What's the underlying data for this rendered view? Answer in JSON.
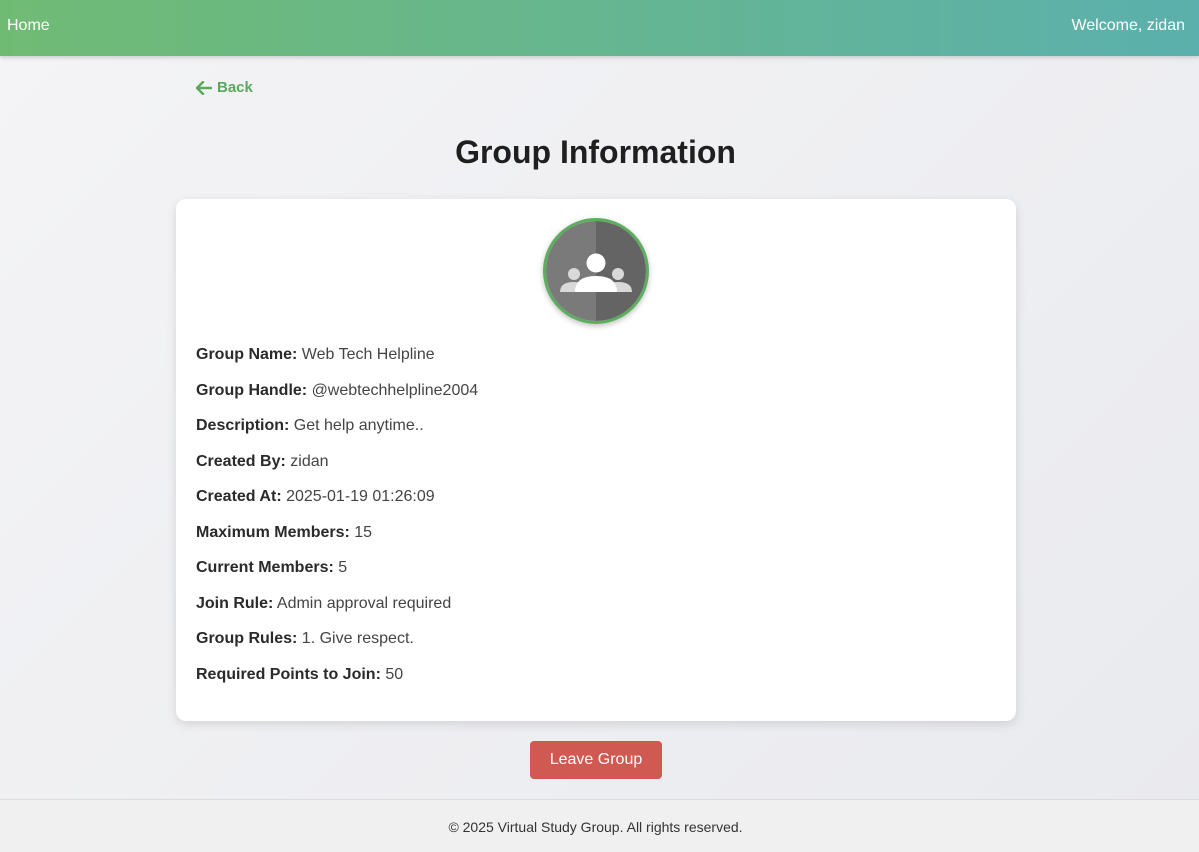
{
  "nav": {
    "home_label": "Home",
    "welcome_text": "Welcome, zidan"
  },
  "back_label": "Back",
  "page_title": "Group Information",
  "group": {
    "avatar_icon": "group-people-icon",
    "fields": [
      {
        "label": "Group Name:",
        "value": "Web Tech Helpline"
      },
      {
        "label": "Group Handle:",
        "value": "@webtechhelpline2004"
      },
      {
        "label": "Description:",
        "value": "Get help anytime.."
      },
      {
        "label": "Created By:",
        "value": "zidan"
      },
      {
        "label": "Created At:",
        "value": "2025-01-19 01:26:09"
      },
      {
        "label": "Maximum Members:",
        "value": "15"
      },
      {
        "label": "Current Members:",
        "value": "5"
      },
      {
        "label": "Join Rule:",
        "value": "Admin approval required"
      },
      {
        "label": "Group Rules:",
        "value": "1. Give respect."
      },
      {
        "label": "Required Points to Join:",
        "value": "50"
      }
    ]
  },
  "leave_button_label": "Leave Group",
  "footer_text": "© 2025 Virtual Study Group. All rights reserved.",
  "colors": {
    "header_gradient_start": "#70bb74",
    "header_gradient_end": "#5bb0ad",
    "accent_green": "#5aa85c",
    "leave_button": "#d05a52"
  }
}
